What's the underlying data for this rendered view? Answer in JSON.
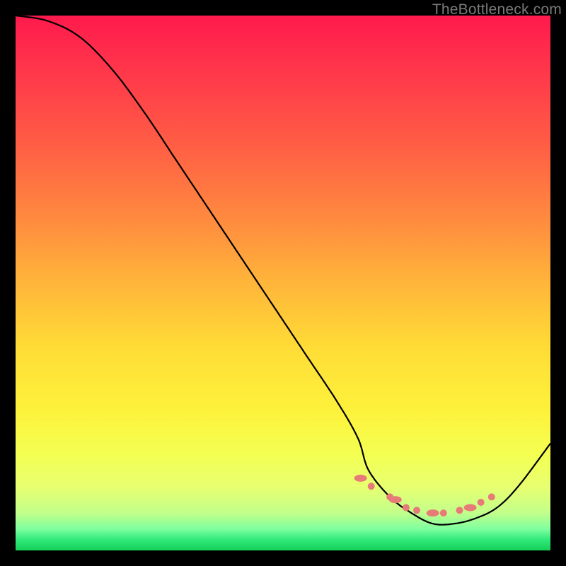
{
  "watermark": "TheBottleneck.com",
  "colors": {
    "frame": "#000000",
    "curve": "#000000",
    "markers": "#e77b77",
    "gradient_top": "#ff1a4d",
    "gradient_bottom": "#17cf57"
  },
  "chart_data": {
    "type": "line",
    "title": "",
    "xlabel": "",
    "ylabel": "",
    "xlim": [
      0,
      100
    ],
    "ylim": [
      0,
      100
    ],
    "x": [
      0,
      6,
      12,
      18,
      24,
      30,
      36,
      42,
      48,
      54,
      60,
      64,
      66,
      70,
      74,
      78,
      82,
      86,
      90,
      94,
      100
    ],
    "values": [
      100,
      99,
      96,
      90,
      82,
      73,
      64,
      55,
      46,
      37,
      28,
      21,
      15,
      10,
      7,
      5,
      5,
      6,
      8,
      12,
      20
    ],
    "markers_x": [
      64.5,
      66.5,
      70,
      71,
      73,
      75,
      78,
      80,
      83,
      85,
      87,
      89
    ],
    "markers_y": [
      13.5,
      12,
      10,
      9.5,
      8,
      7.5,
      7,
      7,
      7.5,
      8,
      9,
      10
    ]
  }
}
